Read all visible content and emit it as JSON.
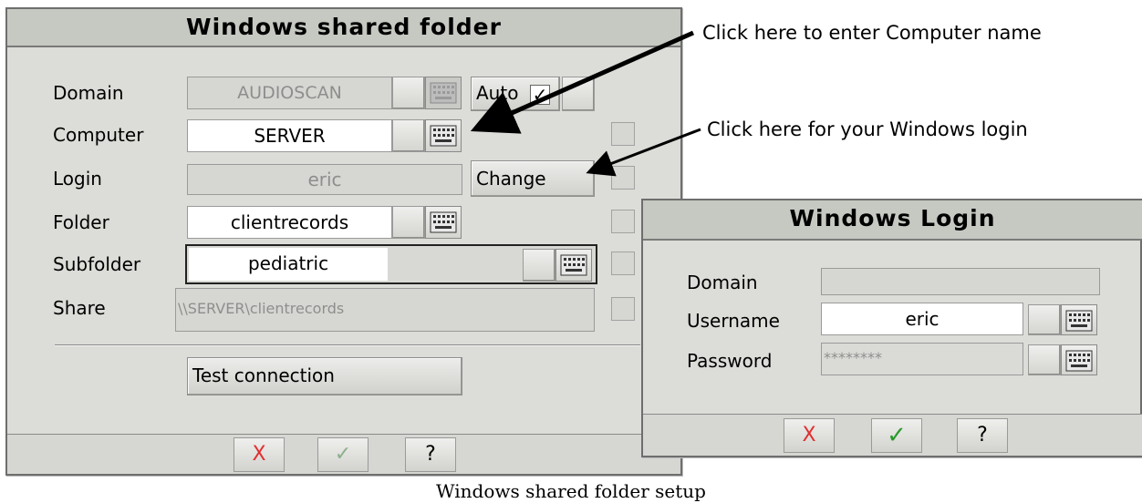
{
  "main_dialog": {
    "title": "Windows shared folder",
    "domain": {
      "label": "Domain",
      "value": "AUDIOSCAN",
      "auto_label": "Auto",
      "auto_checked": true
    },
    "computer": {
      "label": "Computer",
      "value": "SERVER"
    },
    "login": {
      "label": "Login",
      "value": "eric",
      "change_label": "Change"
    },
    "folder": {
      "label": "Folder",
      "value": "clientrecords"
    },
    "subfolder": {
      "label": "Subfolder",
      "value": "pediatric"
    },
    "share": {
      "label": "Share",
      "value": "\\\\SERVER\\clientrecords"
    },
    "test_connection_label": "Test connection",
    "footer": {
      "cancel": "X",
      "ok": "✓",
      "help": "?"
    }
  },
  "login_dialog": {
    "title": "Windows Login",
    "domain": {
      "label": "Domain",
      "value": ""
    },
    "username": {
      "label": "Username",
      "value": "eric"
    },
    "password": {
      "label": "Password",
      "value": "********"
    },
    "footer": {
      "cancel": "X",
      "ok": "✓",
      "help": "?"
    }
  },
  "annotations": {
    "computer_name": "Click here to enter Computer name",
    "windows_login": "Click here for your Windows login"
  },
  "caption": "Windows shared folder setup",
  "colors": {
    "cancel_x": "#e03030",
    "ok_check": "#2a9a2a",
    "ok_check_disabled": "#8cb08c"
  }
}
